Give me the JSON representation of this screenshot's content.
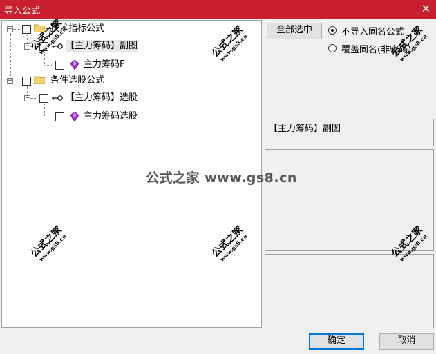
{
  "window": {
    "title": "导入公式",
    "close_glyph": "✕"
  },
  "tree": {
    "nodes": [
      {
        "label": "技术指标公式",
        "type": "folder"
      },
      {
        "label": "【主力筹码】副图",
        "type": "key"
      },
      {
        "label": "主力筹码F",
        "type": "gem"
      },
      {
        "label": "条件选股公式",
        "type": "folder"
      },
      {
        "label": "【主力筹码】选股",
        "type": "key"
      },
      {
        "label": "主力筹码选股",
        "type": "gem"
      }
    ]
  },
  "toolbar": {
    "select_all_label": "全部选中",
    "radio_skip_label": "不导入同名公式",
    "radio_overwrite_label": "覆盖同名(非密码)",
    "selected_option": "skip"
  },
  "info": {
    "selected_name": "【主力筹码】副图"
  },
  "footer": {
    "ok_label": "确定",
    "cancel_label": "取消"
  },
  "watermark": {
    "text": "公式之家 www.gs8.cn",
    "cn": "公式之家",
    "url": "www.gs8.cn"
  },
  "colors": {
    "titlebar": "#c8202e",
    "folder": "#f5d56b",
    "gem": "#9b30c8"
  }
}
